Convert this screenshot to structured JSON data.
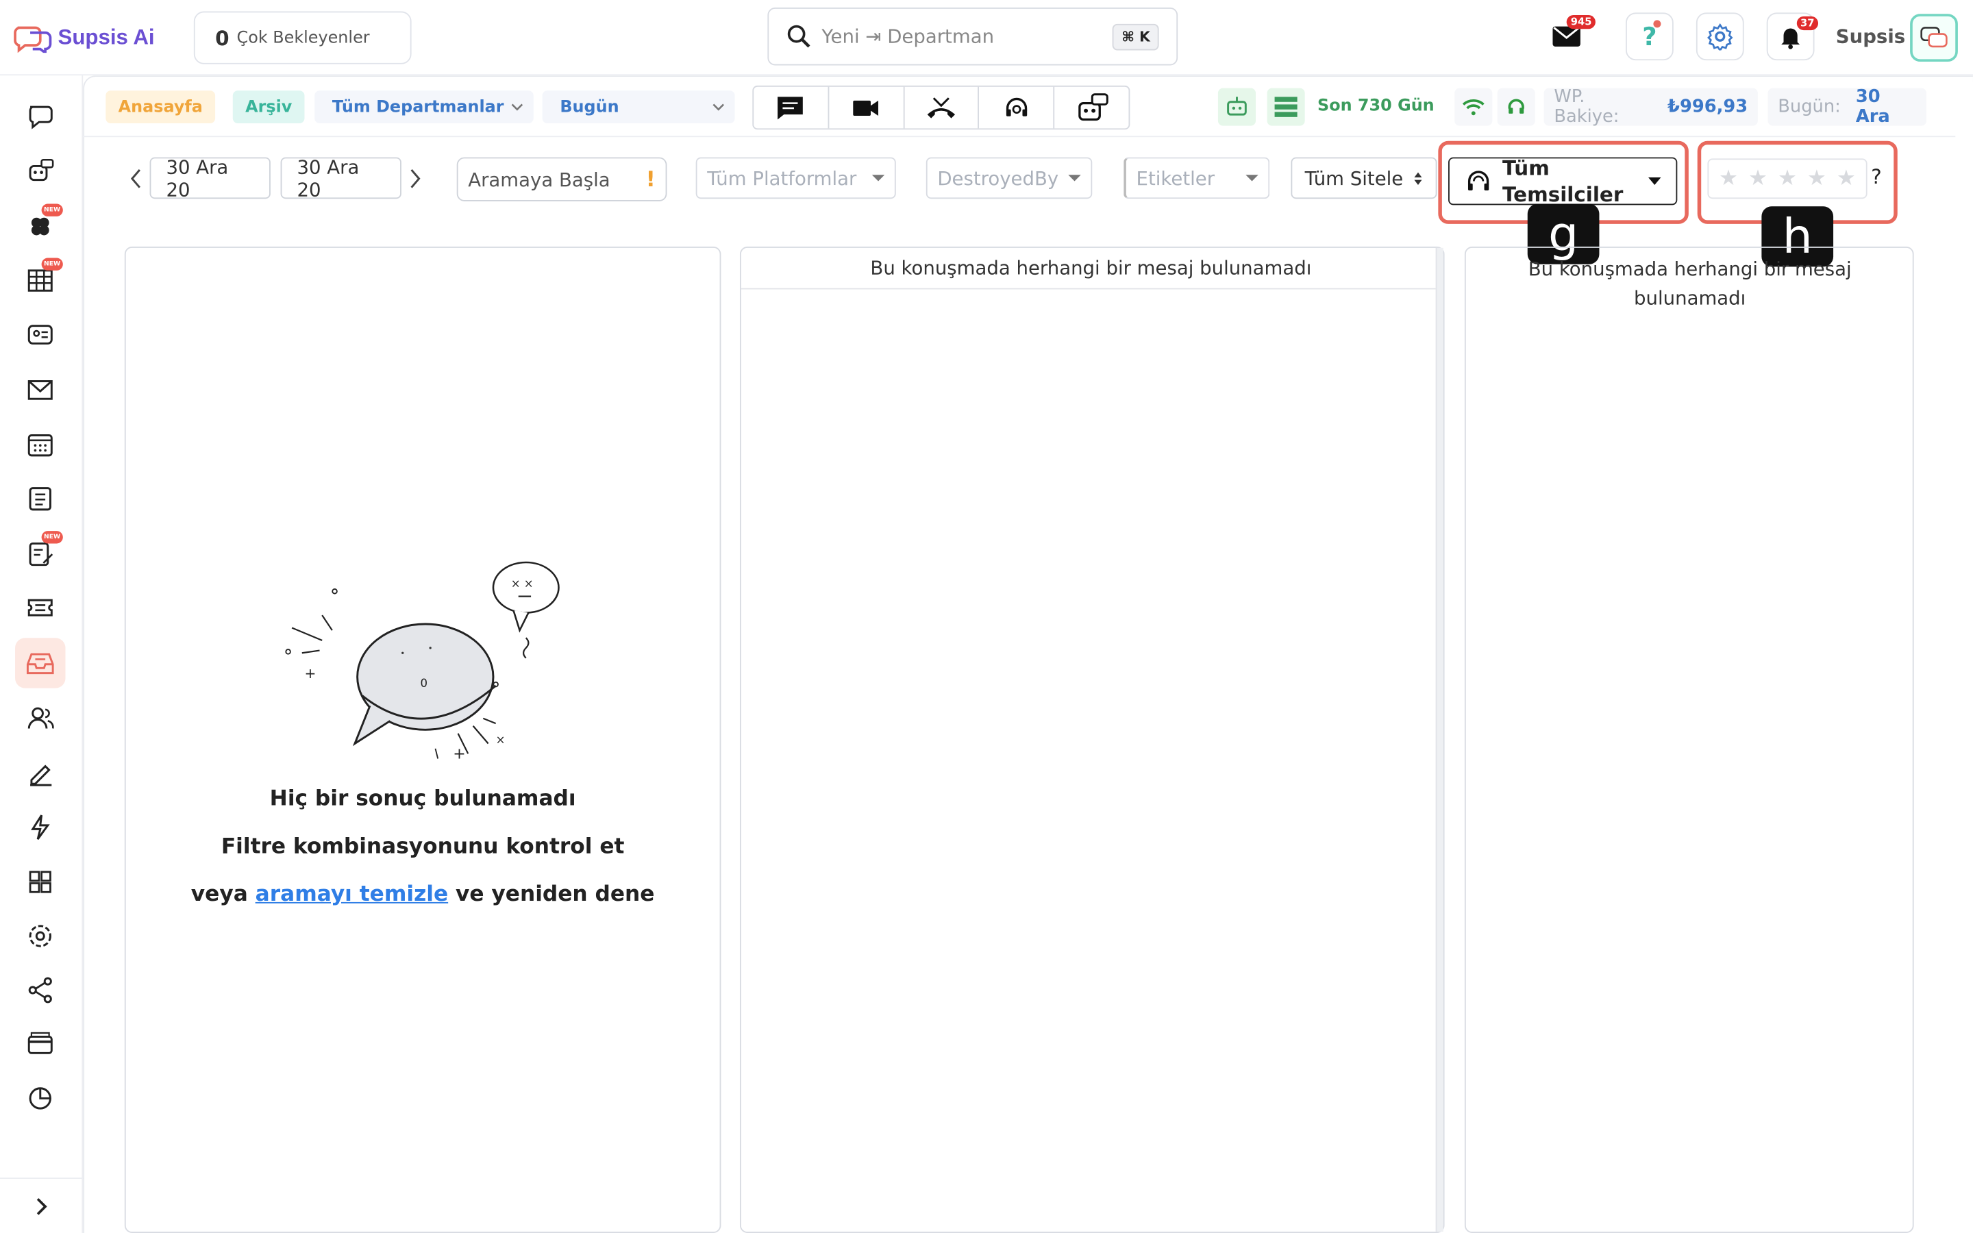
{
  "app": {
    "name": "Supsis Ai",
    "username": "Supsis"
  },
  "topbar": {
    "pending_count": "0",
    "pending_label": "Çok Bekleyenler",
    "search_placeholder": "Yeni ⇥ Departman",
    "search_shortcut": "⌘ K",
    "mail_badge": "945",
    "notif_badge": "37"
  },
  "sidebar": {
    "items": [
      {
        "icon": "chat-bubble-icon"
      },
      {
        "icon": "bot-icon"
      },
      {
        "icon": "flower-icon",
        "badge": "NEW"
      },
      {
        "icon": "table-icon",
        "badge": "NEW"
      },
      {
        "icon": "contact-card-icon"
      },
      {
        "icon": "mail-icon"
      },
      {
        "icon": "calendar-icon"
      },
      {
        "icon": "list-icon"
      },
      {
        "icon": "edit-list-icon",
        "badge": "NEW"
      },
      {
        "icon": "ticket-icon"
      },
      {
        "icon": "archive-inbox-icon",
        "active": true
      },
      {
        "icon": "users-icon"
      },
      {
        "icon": "pen-icon"
      },
      {
        "icon": "lightning-icon"
      },
      {
        "icon": "grid-icon"
      },
      {
        "icon": "gear-icon"
      },
      {
        "icon": "share-icon"
      },
      {
        "icon": "payment-icon"
      },
      {
        "icon": "pie-chart-icon"
      }
    ]
  },
  "subbar": {
    "home": "Anasayfa",
    "archive": "Arşiv",
    "departments": "Tüm Departmanlar",
    "period": "Bugün",
    "range_label": "Son 730 Gün",
    "wp_balance_label": "WP. Bakiye:",
    "wp_balance_value": "₺996,93",
    "today_label": "Bugün:",
    "today_value": "30 Ara"
  },
  "filters": {
    "date_from": "30 Ara 20",
    "date_to": "30 Ara 20",
    "search_call": "Aramaya Başla",
    "platforms": "Tüm Platformlar",
    "destroyed_by": "DestroyedBy",
    "tags": "Etiketler",
    "sites": "Tüm Sitele",
    "representatives": "Tüm Temsilciler",
    "rating_help": "?"
  },
  "annotations": {
    "g": "g",
    "h": "h"
  },
  "panels": {
    "no_message": "Bu konuşmada herhangi bir mesaj bulunamadı",
    "empty_title": "Hiç bir sonuç bulunamadı",
    "empty_sub": "Filtre kombinasyonunu kontrol et",
    "empty_pre": "veya",
    "empty_link": "aramayı temizle",
    "empty_post": "ve yeniden dene"
  },
  "colors": {
    "accent": "#3c78c8",
    "highlight": "#e8695d",
    "brand": "#6b4fd3"
  }
}
